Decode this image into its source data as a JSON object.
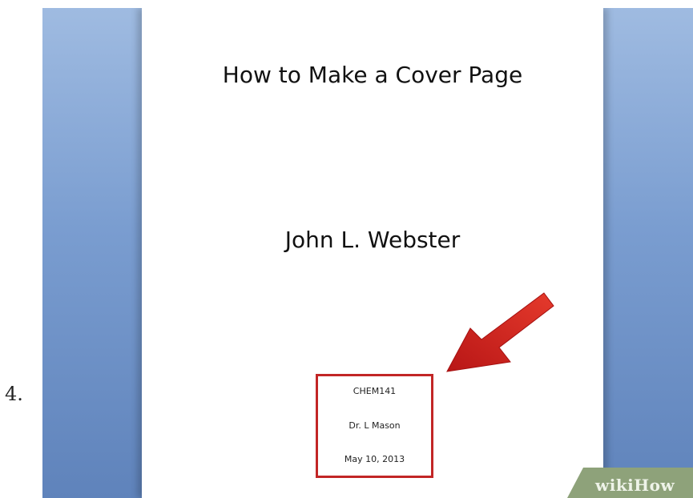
{
  "step": {
    "number": "4."
  },
  "document": {
    "title": "How to Make a Cover Page",
    "author": "John L. Webster",
    "info_lines": [
      "CHEM141",
      "Dr. L Mason",
      "May 10, 2013"
    ]
  },
  "highlight": {
    "color": "#c22626",
    "arrow_icon": "red-arrow-icon"
  },
  "watermark": {
    "text": "wikiHow"
  },
  "colors": {
    "background": "#6f93c8",
    "page": "#ffffff",
    "arrow": "#cc2020",
    "watermark_bg": "#8ea27a"
  }
}
